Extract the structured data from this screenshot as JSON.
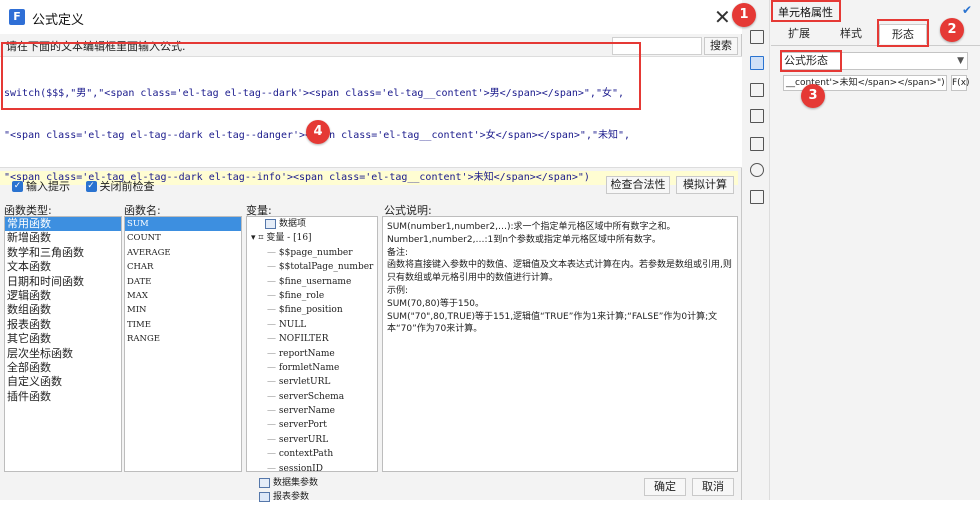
{
  "dialog": {
    "title": "公式定义",
    "prompt": "请在下面的文本编辑框里面输入公式.",
    "search_label": "搜索",
    "code_lines": [
      "switch($$$,\"男\",\"<span class='el-tag el-tag--dark'><span class='el-tag__content'>男</span></span>\",\"女\",",
      "\"<span class='el-tag el-tag--dark el-tag--danger'><span class='el-tag__content'>女</span></span>\",\"未知\",",
      "\"<span class='el-tag el-tag--dark el-tag--info'><span class='el-tag__content'>未知</span></span>\")"
    ],
    "input_hint_label": "输入提示",
    "close_check_label": "关闭前检查",
    "check_validity_label": "检查合法性",
    "simulate_label": "模拟计算",
    "ok_label": "确定",
    "cancel_label": "取消"
  },
  "panels": {
    "func_type_label": "函数类型:",
    "func_name_label": "函数名:",
    "var_label": "变量:",
    "desc_label": "公式说明:",
    "func_types": [
      "常用函数",
      "新增函数",
      "数学和三角函数",
      "文本函数",
      "日期和时间函数",
      "逻辑函数",
      "数组函数",
      "报表函数",
      "其它函数",
      "层次坐标函数",
      "全部函数",
      "自定义函数",
      "插件函数"
    ],
    "func_names": [
      "SUM",
      "COUNT",
      "AVERAGE",
      "CHAR",
      "DATE",
      "MAX",
      "MIN",
      "TIME",
      "RANGE"
    ],
    "variables": {
      "data_item": "数据项",
      "var_group": "变量 - [16]",
      "items": [
        "$$page_number",
        "$$totalPage_number",
        "$fine_username",
        "$fine_role",
        "$fine_position",
        "NULL",
        "NOFILTER",
        "reportName",
        "formletName",
        "servletURL",
        "serverSchema",
        "serverName",
        "serverPort",
        "serverURL",
        "contextPath",
        "sessionID"
      ],
      "dataset_params": "数据集参数",
      "report_params": "报表参数"
    },
    "description_lines": [
      "SUM(number1,number2,…):求一个指定单元格区域中所有数字之和。",
      "Number1,number2,…:1到n个参数或指定单元格区域中所有数字。",
      "备注:",
      "函数将直接键入参数中的数值、逻辑值及文本表达式计算在内。若参数是数组或引用,则只有数组或单元格引用中的数值进行计算。",
      "示例:",
      "SUM(70,80)等于150。",
      "SUM(\"70\",80,TRUE)等于151,逻辑值“TRUE”作为1来计算;“FALSE”作为0计算;文本“70”作为70来计算。"
    ]
  },
  "props": {
    "title": "单元格属性",
    "tabs": [
      "扩展",
      "样式",
      "形态"
    ],
    "form_select": "公式形态",
    "formula_field": "__content'>未知</span></span>\")",
    "fx_label": "F(x)"
  },
  "badges": [
    "1",
    "2",
    "3",
    "4"
  ]
}
